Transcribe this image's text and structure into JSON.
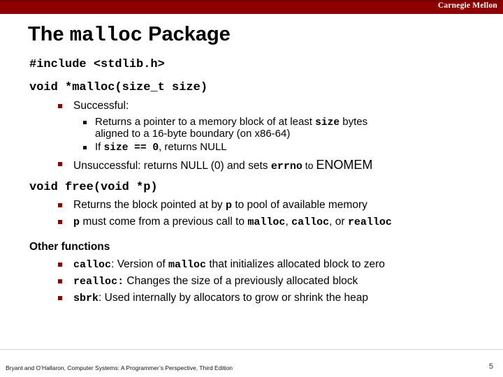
{
  "header": {
    "brand": "Carnegie Mellon",
    "band_color": "#8E0000",
    "brand_color": "#FFFFFF"
  },
  "title": {
    "prefix": "The ",
    "mono": "malloc",
    "suffix": " Package"
  },
  "content": {
    "include_line": "#include <stdlib.h>",
    "malloc_signature": "void *malloc(size_t size)",
    "successful_label": "Successful:",
    "returns_pointer_a": "Returns a pointer to a memory block of at least ",
    "returns_pointer_size": "size",
    "returns_pointer_b": " bytes",
    "returns_pointer_line2": "aligned to a 16-byte boundary (on x86-64)",
    "if_prefix": "If ",
    "if_code": "size == 0",
    "if_suffix": ", returns NULL",
    "unsuccessful_a": "Unsuccessful: returns NULL (0) and sets ",
    "unsuccessful_errno": "errno",
    "unsuccessful_to": " to ",
    "unsuccessful_enomem": "ENOMEM",
    "free_signature": "void free(void *p)",
    "free_bullet1_a": "Returns the block pointed at by ",
    "free_bullet1_p": "p",
    "free_bullet1_b": " to pool of available memory",
    "free_bullet2_p": "p",
    "free_bullet2_a": " must come from a previous call to ",
    "free_bullet2_malloc": "malloc",
    "free_bullet2_sep1": ", ",
    "free_bullet2_calloc": "calloc",
    "free_bullet2_sep2": ", or ",
    "free_bullet2_realloc": "realloc",
    "other_functions_head": "Other functions",
    "calloc_name": "calloc",
    "calloc_desc_a": ": Version of ",
    "calloc_desc_mono": "malloc",
    "calloc_desc_b": " that initializes allocated block to zero",
    "realloc_name": "realloc:",
    "realloc_desc": " Changes the size of a previously allocated block",
    "sbrk_name": "sbrk",
    "sbrk_desc": ": Used internally by allocators to grow or shrink the heap"
  },
  "footer": {
    "citation": "Bryant and O’Hallaron, Computer Systems: A Programmer’s Perspective, Third Edition",
    "page_number": "5"
  }
}
